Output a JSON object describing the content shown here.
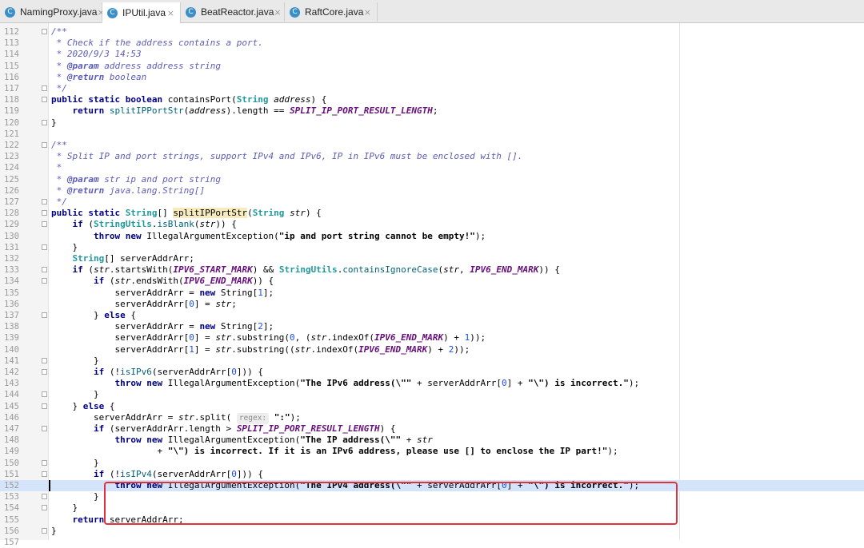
{
  "tabs": [
    {
      "name": "NamingProxy.java",
      "icon": "c-class-icon",
      "active": false
    },
    {
      "name": "IPUtil.java",
      "icon": "c-class-icon",
      "active": true
    },
    {
      "name": "BeatReactor.java",
      "icon": "c-class-icon",
      "active": false
    },
    {
      "name": "RaftCore.java",
      "icon": "c-class-icon",
      "active": false
    }
  ],
  "tab_icon_letter": "C",
  "tab_close_glyph": "×",
  "editor": {
    "current_line": 152,
    "highlight_box_lines": [
      151,
      153
    ],
    "lines": [
      {
        "n": "112",
        "html": "        <span class='cm'>/**</span>"
      },
      {
        "n": "113",
        "html": "         <span class='cm'>* Check if the address contains a port.</span>"
      },
      {
        "n": "114",
        "html": "         <span class='cm'>* 2020/9/3 14:53</span>"
      },
      {
        "n": "115",
        "html": "         <span class='cm'>* <span class='cmt'>@param</span> address address string</span>"
      },
      {
        "n": "116",
        "html": "         <span class='cm'>* <span class='cmt'>@return</span> boolean</span>"
      },
      {
        "n": "117",
        "html": "         <span class='cm'>*/</span>"
      },
      {
        "n": "118",
        "html": "        <span class='kw'>public static boolean</span> containsPort(<span class='cls'>String</span> <span class='param'>address</span>) {"
      },
      {
        "n": "119",
        "html": "            <span class='kw'>return</span> <span class='mcall'>splitIPPortStr</span>(<span class='param'>address</span>).length == <span class='field'>SPLIT_IP_PORT_RESULT_LENGTH</span>;"
      },
      {
        "n": "120",
        "html": "        }"
      },
      {
        "n": "121",
        "html": ""
      },
      {
        "n": "122",
        "html": "        <span class='cm'>/**</span>"
      },
      {
        "n": "123",
        "html": "         <span class='cm'>* Split IP and port strings, support IPv4 and IPv6, IP in IPv6 must be enclosed with [].</span>"
      },
      {
        "n": "124",
        "html": "         <span class='cm'>*</span>"
      },
      {
        "n": "125",
        "html": "         <span class='cm'>* <span class='cmt'>@param</span> str ip and port string</span>"
      },
      {
        "n": "126",
        "html": "         <span class='cm'>* <span class='cmt'>@return</span> java.lang.String[]</span>"
      },
      {
        "n": "127",
        "html": "         <span class='cm'>*/</span>"
      },
      {
        "n": "128",
        "html": "        <span class='kw'>public static</span> <span class='cls'>String</span>[] <span class='hl'>splitIPPortStr</span>(<span class='cls'>String</span> <span class='param'>str</span>) {"
      },
      {
        "n": "129",
        "html": "            <span class='kw'>if</span> (<span class='cls'>StringUtils</span>.<span class='mcall'>isBlank</span>(<span class='param'>str</span>)) {"
      },
      {
        "n": "130",
        "html": "                <span class='kw'>throw new</span> IllegalArgumentException(<span class='st'>\"ip and port string cannot be empty!\"</span>);"
      },
      {
        "n": "131",
        "html": "            }"
      },
      {
        "n": "132",
        "html": "            <span class='cls'>String</span>[] serverAddrArr;"
      },
      {
        "n": "133",
        "html": "            <span class='kw'>if</span> (<span class='param'>str</span>.startsWith(<span class='field'>IPV6_START_MARK</span>) &amp;&amp; <span class='cls'>StringUtils</span>.<span class='mcall'>containsIgnoreCase</span>(<span class='param'>str</span>, <span class='field'>IPV6_END_MARK</span>)) {"
      },
      {
        "n": "134",
        "html": "                <span class='kw'>if</span> (<span class='param'>str</span>.endsWith(<span class='field'>IPV6_END_MARK</span>)) {"
      },
      {
        "n": "135",
        "html": "                    serverAddrArr = <span class='kw'>new</span> String[<span class='num'>1</span>];"
      },
      {
        "n": "136",
        "html": "                    serverAddrArr[<span class='num'>0</span>] = <span class='param'>str</span>;"
      },
      {
        "n": "137",
        "html": "                } <span class='kw'>else</span> {"
      },
      {
        "n": "138",
        "html": "                    serverAddrArr = <span class='kw'>new</span> String[<span class='num'>2</span>];"
      },
      {
        "n": "139",
        "html": "                    serverAddrArr[<span class='num'>0</span>] = <span class='param'>str</span>.substring(<span class='num'>0</span>, (<span class='param'>str</span>.indexOf(<span class='field'>IPV6_END_MARK</span>) + <span class='num'>1</span>));"
      },
      {
        "n": "140",
        "html": "                    serverAddrArr[<span class='num'>1</span>] = <span class='param'>str</span>.substring((<span class='param'>str</span>.indexOf(<span class='field'>IPV6_END_MARK</span>) + <span class='num'>2</span>));"
      },
      {
        "n": "141",
        "html": "                }"
      },
      {
        "n": "142",
        "html": "                <span class='kw'>if</span> (!<span class='mcall'>isIPv6</span>(serverAddrArr[<span class='num'>0</span>])) {"
      },
      {
        "n": "143",
        "html": "                    <span class='kw'>throw new</span> IllegalArgumentException(<span class='st'>\"The IPv6 address(\\\"\"</span> + serverAddrArr[<span class='num'>0</span>] + <span class='st'>\"\\\") is incorrect.\"</span>);"
      },
      {
        "n": "144",
        "html": "                }"
      },
      {
        "n": "145",
        "html": "            } <span class='kw'>else</span> {"
      },
      {
        "n": "146",
        "html": "                serverAddrArr = <span class='param'>str</span>.split( <span class='hint'>regex:</span> <span class='st'>\":\"</span>);"
      },
      {
        "n": "147",
        "html": "                <span class='kw'>if</span> (serverAddrArr.length &gt; <span class='field'>SPLIT_IP_PORT_RESULT_LENGTH</span>) {"
      },
      {
        "n": "148",
        "html": "                    <span class='kw'>throw new</span> IllegalArgumentException(<span class='st'>\"The IP address(\\\"\"</span> + <span class='param'>str</span>"
      },
      {
        "n": "149",
        "html": "                            + <span class='st'>\"\\\") is incorrect. If it is an IPv6 address, please use [] to enclose the IP part!\"</span>);"
      },
      {
        "n": "150",
        "html": "                }"
      },
      {
        "n": "151",
        "html": "                <span class='kw'>if</span> (!<span class='mcall'>isIPv4</span>(serverAddrArr[<span class='num'>0</span>])) {"
      },
      {
        "n": "152",
        "html": "                    <span class='kw'>throw new</span> IllegalArgumentException(<span class='st'>\"The IPv4 address(\\\"\"</span> + serverAddrArr[<span class='num'>0</span>] + <span class='st'>\"\\\") is incorrect.\"</span>);"
      },
      {
        "n": "153",
        "html": "                }"
      },
      {
        "n": "154",
        "html": "            }"
      },
      {
        "n": "155",
        "html": "            <span class='kw'>return</span> serverAddrArr;"
      },
      {
        "n": "156",
        "html": "        }"
      },
      {
        "n": "157",
        "html": ""
      }
    ],
    "fold_markers": [
      "112",
      "117",
      "118",
      "120",
      "122",
      "127",
      "128",
      "129",
      "131",
      "133",
      "134",
      "137",
      "141",
      "142",
      "144",
      "145",
      "147",
      "150",
      "151",
      "153",
      "154",
      "156"
    ]
  }
}
